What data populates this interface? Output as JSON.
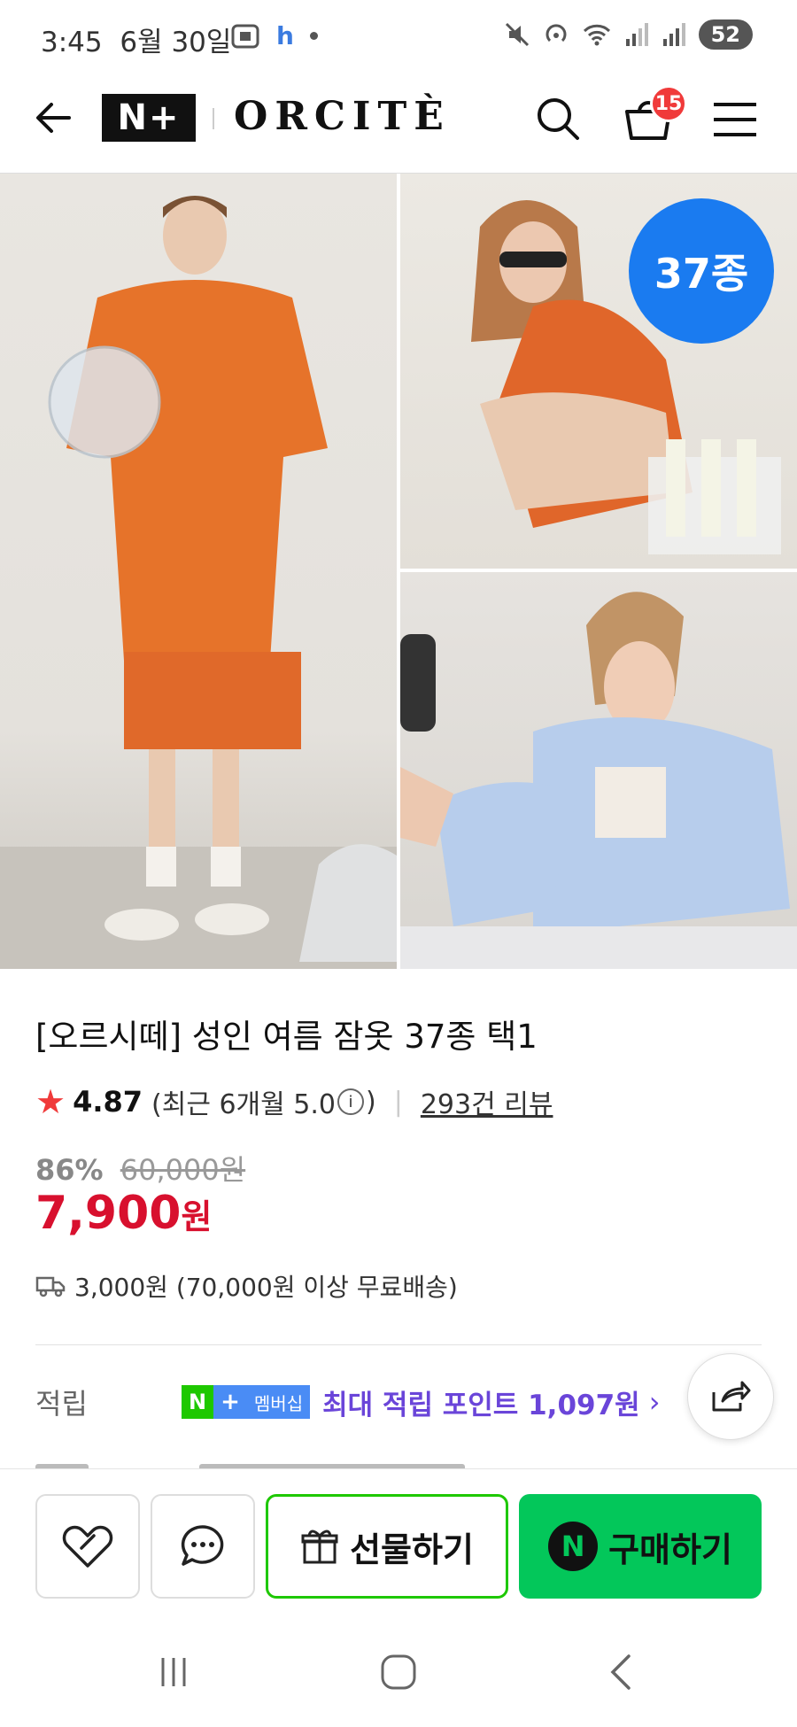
{
  "status_bar": {
    "time": "3:45",
    "date": "6월 30일",
    "app_letter": "h",
    "battery": "52"
  },
  "header": {
    "logo_badge": "N+",
    "brand": "ORCITÈ",
    "cart_count": "15",
    "icons": [
      "back-arrow-icon",
      "search-icon",
      "cart-icon",
      "menu-icon"
    ]
  },
  "gallery": {
    "variant_badge": "37종"
  },
  "product": {
    "title": "[오르시떼] 성인 여름 잠옷 37종 택1",
    "rating": "4.87",
    "recent_rating_prefix": "(최근 6개월 5.0",
    "recent_rating_suffix": ")",
    "review_link": "293건 리뷰",
    "discount": "86%",
    "original_price": "60,000원",
    "price_number": "7,900",
    "price_unit": "원",
    "shipping": "3,000원 (70,000원 이상 무료배송)"
  },
  "earn": {
    "label": "적립",
    "tag_n": "N",
    "tag_plus": "+",
    "tag_member": "멤버십",
    "text": "최대 적립 포인트 1,097원",
    "chevron": "›"
  },
  "actions": {
    "gift": "선물하기",
    "buy": "구매하기",
    "buy_n": "N"
  },
  "colors": {
    "brand_green": "#03c75a",
    "price_red": "#d8102e",
    "badge_blue": "#1a7bf0",
    "earn_purple": "#6a45d9"
  }
}
